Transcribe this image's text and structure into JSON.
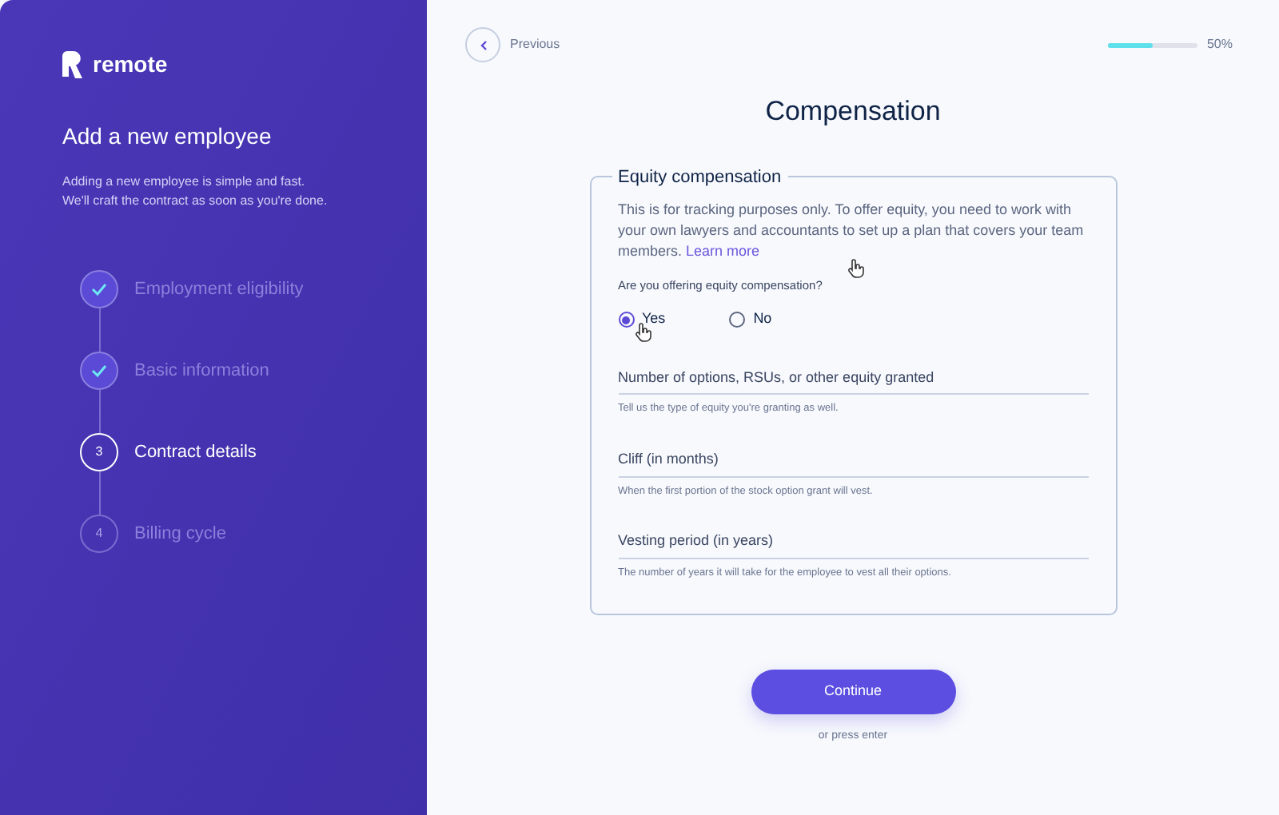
{
  "sidebar": {
    "logo": "remote",
    "title": "Add a new employee",
    "subtitle": "Adding a new employee is simple and fast.\nWe'll craft the contract as soon as you're done.",
    "steps": [
      {
        "label": "Employment eligibility",
        "done": true,
        "selected": false
      },
      {
        "label": "Basic information",
        "done": true,
        "selected": false
      },
      {
        "label": "Contract details",
        "number": "3",
        "done": false,
        "selected": true
      },
      {
        "label": "Billing cycle",
        "number": "4",
        "done": false,
        "selected": false
      }
    ]
  },
  "header": {
    "previous": "Previous",
    "progress": {
      "level": 0.5,
      "reading": "50%"
    }
  },
  "title": "Compensation",
  "section": {
    "legend": "Equity compensation",
    "description": "This is for tracking purposes only. To offer equity, you need to work with your own lawyers and accountants to set up a plan that covers your team members.",
    "link": "Learn more",
    "question": "Are you offering equity compensation?",
    "options": [
      {
        "label": "Yes",
        "selected": true
      },
      {
        "label": "No",
        "selected": false
      }
    ],
    "fields": [
      {
        "label": "Number of options, RSUs, or other equity granted",
        "help": "Tell us the type of equity you're granting as well."
      },
      {
        "label": "Cliff (in months)",
        "help": "When the first portion of the stock option grant will vest."
      },
      {
        "label": "Vesting period (in years)",
        "help": "The number of years it will take for the employee to vest all their options."
      }
    ]
  },
  "continue": "Continue",
  "hint": "or press enter"
}
